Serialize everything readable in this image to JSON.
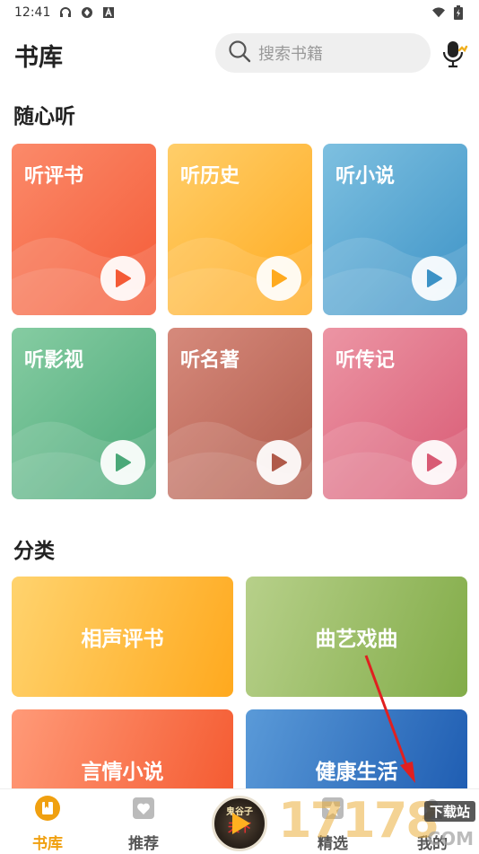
{
  "status_bar": {
    "time": "12:41",
    "icons_left": [
      "headset-icon",
      "shield-icon",
      "a-icon"
    ],
    "icons_right": [
      "wifi-icon",
      "battery-icon"
    ]
  },
  "header": {
    "title": "书库",
    "search_placeholder": "搜索书籍",
    "mic_icon": "microphone-icon"
  },
  "listen_section": {
    "title": "随心听",
    "items": [
      {
        "label": "听评书",
        "color_from": "#fb8a6a",
        "color_to": "#f45a36"
      },
      {
        "label": "听历史",
        "color_from": "#ffce6a",
        "color_to": "#ffaa1e"
      },
      {
        "label": "听小说",
        "color_from": "#7ec0e0",
        "color_to": "#3c92c6"
      },
      {
        "label": "听影视",
        "color_from": "#86cca2",
        "color_to": "#4aa878"
      },
      {
        "label": "听名著",
        "color_from": "#d68a7c",
        "color_to": "#b05a4a"
      },
      {
        "label": "听传记",
        "color_from": "#ec95a4",
        "color_to": "#d85a74"
      }
    ]
  },
  "category_section": {
    "title": "分类",
    "items": [
      {
        "label": "相声评书",
        "color_from": "#ffd36e",
        "color_to": "#ffa91e"
      },
      {
        "label": "曲艺戏曲",
        "color_from": "#b7d08a",
        "color_to": "#82ac48"
      },
      {
        "label": "言情小说",
        "color_from": "#ff9a78",
        "color_to": "#f4582e"
      },
      {
        "label": "健康生活",
        "color_from": "#5a9ad8",
        "color_to": "#1c5ab0"
      }
    ]
  },
  "tab_bar": {
    "tabs": [
      {
        "label": "书库",
        "icon": "bookshelf-icon",
        "active": true
      },
      {
        "label": "推荐",
        "icon": "heart-icon",
        "active": false
      },
      {
        "label": "精选",
        "icon": "star-icon",
        "active": false
      },
      {
        "label": "我的",
        "icon": "profile-icon",
        "active": false
      }
    ],
    "player": {
      "line1": "鬼谷子",
      "line2": "天下"
    }
  },
  "watermark": {
    "digits": "17178",
    "tag": "下载站",
    "suffix": ".COM"
  },
  "colors": {
    "accent": "#f0a010",
    "annotation_arrow": "#e02020"
  }
}
